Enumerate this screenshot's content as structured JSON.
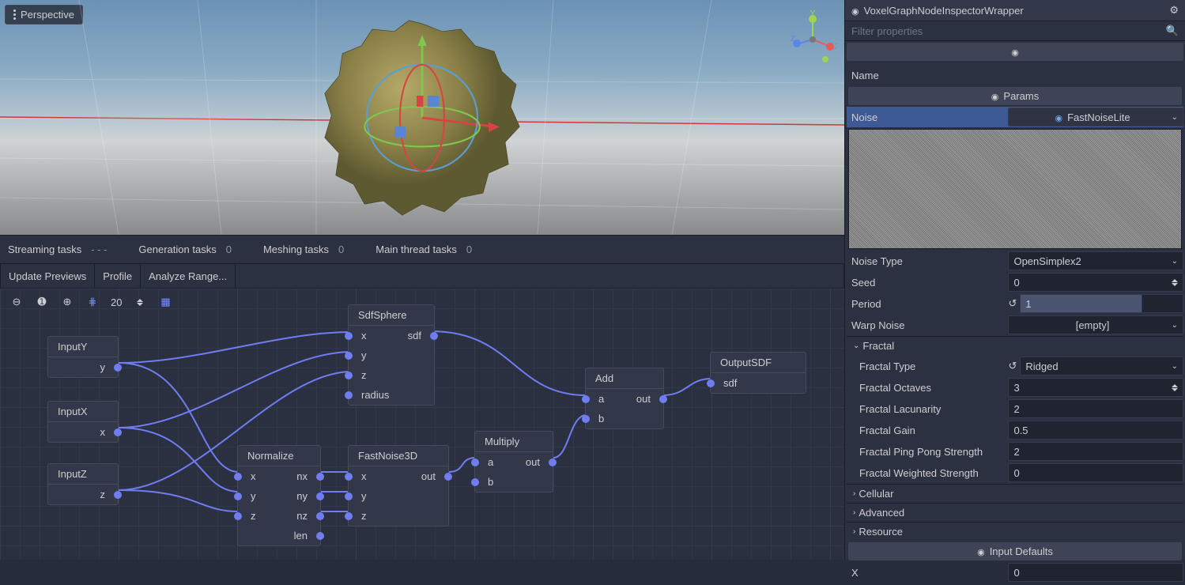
{
  "viewport": {
    "perspective_label": "Perspective"
  },
  "status": {
    "streaming_label": "Streaming tasks",
    "streaming_val": "- - -",
    "generation_label": "Generation tasks",
    "generation_val": "0",
    "meshing_label": "Meshing tasks",
    "meshing_val": "0",
    "mainthread_label": "Main thread tasks",
    "mainthread_val": "0"
  },
  "toolbar": {
    "update": "Update Previews",
    "profile": "Profile",
    "analyze": "Analyze Range..."
  },
  "graph": {
    "zoom": "20"
  },
  "nodes": {
    "inputY": {
      "title": "InputY",
      "out": "y"
    },
    "inputX": {
      "title": "InputX",
      "out": "x"
    },
    "inputZ": {
      "title": "InputZ",
      "out": "z"
    },
    "sdfSphere": {
      "title": "SdfSphere",
      "x": "x",
      "y": "y",
      "z": "z",
      "radius": "radius",
      "sdf": "sdf"
    },
    "normalize": {
      "title": "Normalize",
      "x": "x",
      "y": "y",
      "z": "z",
      "nx": "nx",
      "ny": "ny",
      "nz": "nz",
      "len": "len"
    },
    "fastNoise": {
      "title": "FastNoise3D",
      "x": "x",
      "y": "y",
      "z": "z",
      "out": "out"
    },
    "multiply": {
      "title": "Multiply",
      "a": "a",
      "b": "b",
      "out": "out"
    },
    "add": {
      "title": "Add",
      "a": "a",
      "b": "b",
      "out": "out"
    },
    "outputSDF": {
      "title": "OutputSDF",
      "sdf": "sdf"
    }
  },
  "inspector": {
    "title": "VoxelGraphNodeInspectorWrapper",
    "filter_placeholder": "Filter properties",
    "subheader": "VoxelGraphNodeInspectorWrapper",
    "name_label": "Name",
    "params_label": "Params",
    "noise_label": "Noise",
    "noise_value": "FastNoiseLite",
    "noise_type_label": "Noise Type",
    "noise_type_value": "OpenSimplex2",
    "seed_label": "Seed",
    "seed_value": "0",
    "period_label": "Period",
    "period_value": "1",
    "warp_label": "Warp Noise",
    "warp_value": "[empty]",
    "fractal_label": "Fractal",
    "fractal_type_label": "Fractal Type",
    "fractal_type_value": "Ridged",
    "fractal_octaves_label": "Fractal Octaves",
    "fractal_octaves_value": "3",
    "fractal_lacunarity_label": "Fractal Lacunarity",
    "fractal_lacunarity_value": "2",
    "fractal_gain_label": "Fractal Gain",
    "fractal_gain_value": "0.5",
    "fractal_pingpong_label": "Fractal Ping Pong Strength",
    "fractal_pingpong_value": "2",
    "fractal_weighted_label": "Fractal Weighted Strength",
    "fractal_weighted_value": "0",
    "cellular_label": "Cellular",
    "advanced_label": "Advanced",
    "resource_label": "Resource",
    "input_defaults_label": "Input Defaults",
    "x_label": "X",
    "x_value": "0"
  }
}
